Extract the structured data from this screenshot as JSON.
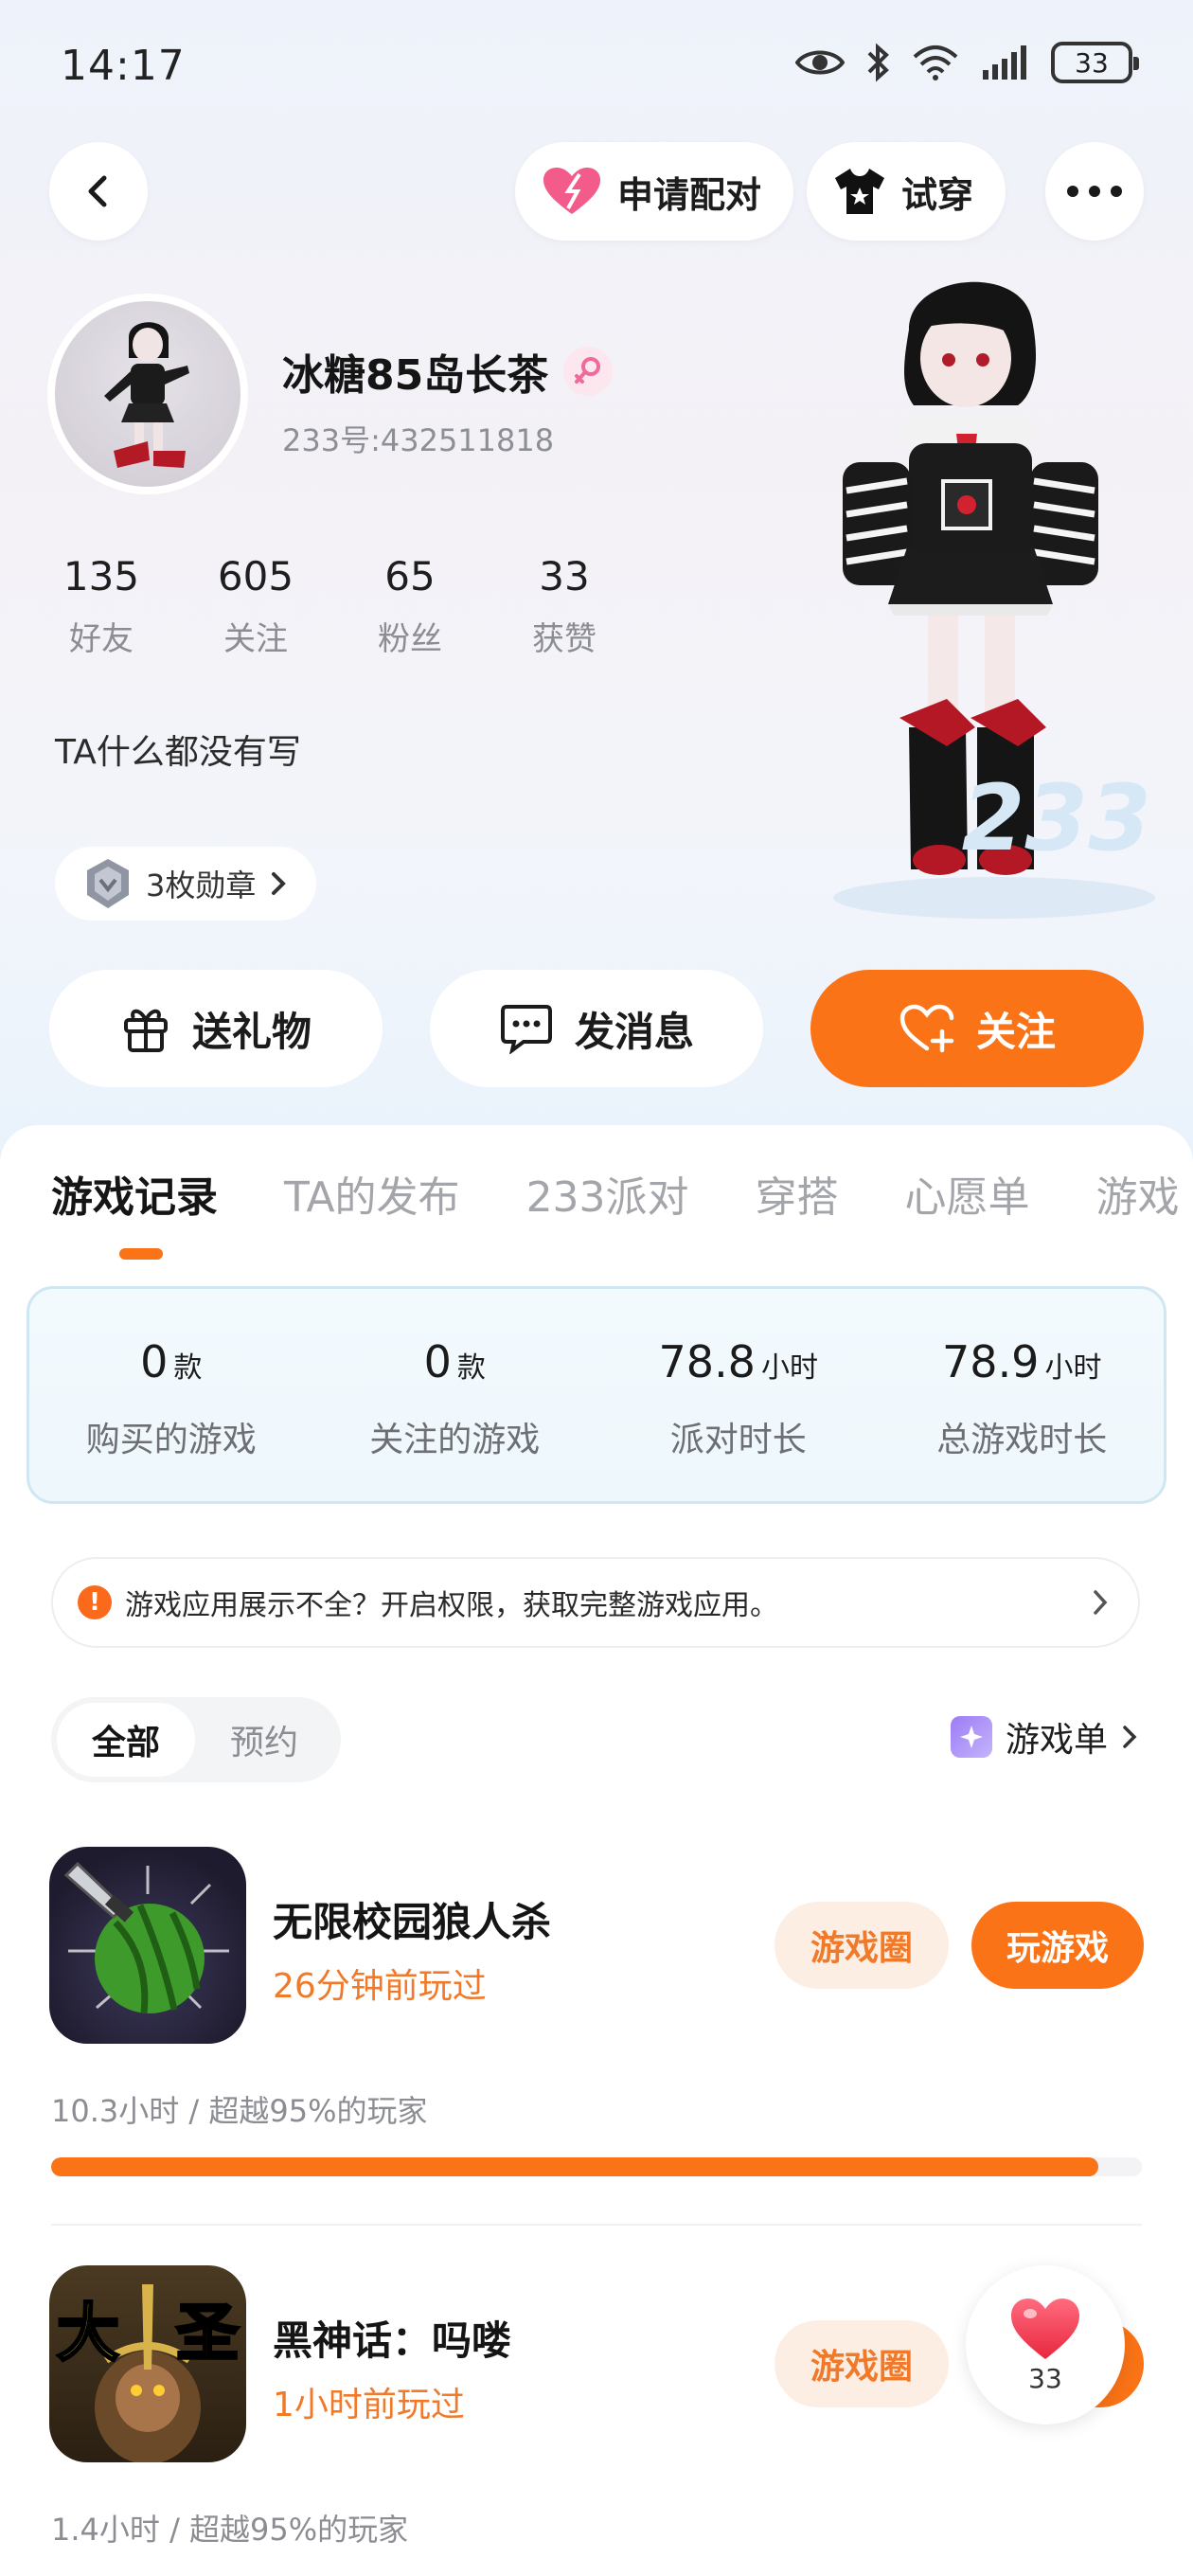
{
  "status_bar": {
    "time": "14:17",
    "battery": "33"
  },
  "header": {
    "match_label": "申请配对",
    "tryon_label": "试穿"
  },
  "profile": {
    "nickname": "冰糖85岛长茶",
    "uid": "233号:432511818",
    "bio": "TA什么都没有写",
    "medals": "3枚勋章",
    "stats": [
      {
        "num": "135",
        "label": "好友"
      },
      {
        "num": "605",
        "label": "关注"
      },
      {
        "num": "65",
        "label": "粉丝"
      },
      {
        "num": "33",
        "label": "获赞"
      }
    ],
    "brand_mark": "233"
  },
  "actions": {
    "gift": "送礼物",
    "message": "发消息",
    "follow": "关注"
  },
  "tabs": [
    "游戏记录",
    "TA的发布",
    "233派对",
    "穿搭",
    "心愿单",
    "游戏"
  ],
  "summary": [
    {
      "num": "0",
      "unit": "款",
      "label": "购买的游戏"
    },
    {
      "num": "0",
      "unit": "款",
      "label": "关注的游戏"
    },
    {
      "num": "78.8",
      "unit": "小时",
      "label": "派对时长"
    },
    {
      "num": "78.9",
      "unit": "小时",
      "label": "总游戏时长"
    }
  ],
  "notice": "游戏应用展示不全？开启权限，获取完整游戏应用。",
  "filter": {
    "all": "全部",
    "reserve": "预约",
    "game_list": "游戏单"
  },
  "games": [
    {
      "name": "无限校园狼人杀",
      "last_played": "26分钟前玩过",
      "meta": "10.3小时 / 超越95%的玩家",
      "progress": 0.96,
      "circle_label": "游戏圈",
      "play_label": "玩游戏"
    },
    {
      "name": "黑神话：吗喽",
      "last_played": "1小时前玩过",
      "meta": "1.4小时 / 超越95%的玩家",
      "circle_label": "游戏圈",
      "icon_text_left": "大",
      "icon_text_right": "圣"
    }
  ],
  "like_count": "33",
  "colors": {
    "accent": "#fa7316",
    "accent_light": "#fdeee3",
    "text_muted": "#8b8d93"
  }
}
